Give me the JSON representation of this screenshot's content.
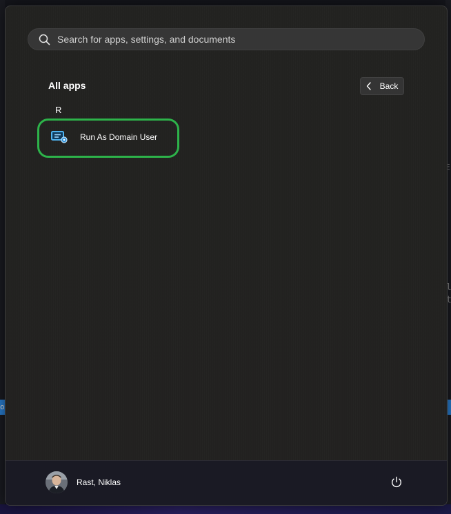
{
  "background": {
    "right_glyph_1": "E",
    "right_glyph_2": "l",
    "right_glyph_3": "t",
    "left_glyph": "oj"
  },
  "search": {
    "placeholder": "Search for apps, settings, and documents",
    "icon": "search-icon"
  },
  "all_apps": {
    "title": "All apps",
    "back_label": "Back",
    "back_icon": "chevron-left-icon"
  },
  "groups": [
    {
      "letter": "R",
      "apps": [
        {
          "label": "Run As Domain User",
          "icon": "run-as-domain-user-icon"
        }
      ]
    }
  ],
  "footer": {
    "user_name": "Rast, Niklas",
    "power_icon": "power-icon"
  },
  "colors": {
    "highlight_ring": "#2db34a",
    "panel_bg": "#222220",
    "footer_bg": "#1a1a24",
    "app_icon_blue": "#4fb3f0"
  }
}
